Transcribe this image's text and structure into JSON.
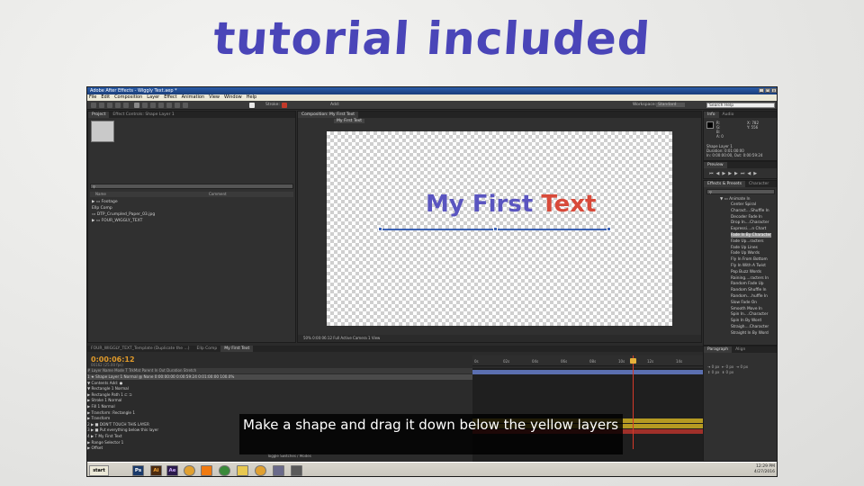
{
  "headline": "tutorial included",
  "window": {
    "title": "Adobe After Effects - Wiggly Text.aep *"
  },
  "menu": [
    "File",
    "Edit",
    "Composition",
    "Layer",
    "Effect",
    "Animation",
    "View",
    "Window",
    "Help"
  ],
  "toolbar": {
    "workspace_label": "Workspace:",
    "workspace_value": "Standard",
    "search_help": "Search Help",
    "stroke_label": "Stroke:",
    "add_label": "Add:"
  },
  "project_panel": {
    "tabs": [
      "Project",
      "Effect Controls: Shape Layer 1"
    ],
    "col_name": "Name",
    "col_comment": "Comment",
    "items": [
      "Footage",
      "Ellp Comp",
      "DTP_Crumpled_Paper_03.jpg",
      "FOUR_WIGGLY_TEXT"
    ]
  },
  "composition_panel": {
    "tab": "Composition: My First Text",
    "sub_tab": "My First Text",
    "text_part1": "My First ",
    "text_part2": "Text",
    "footer": "50%   0:00:06:12   Full   Active Camera   1 View"
  },
  "info_panel": {
    "tabs": [
      "Info",
      "Audio"
    ],
    "rgba": "R:\nG:\nB:\nA: 0",
    "xy": "X: 782\nY: 556",
    "layer": "Shape Layer 1",
    "duration": "Duration: 0:01:00:00",
    "inout": "In: 0:00:00:00, Out: 0:00:59:24"
  },
  "preview_panel": {
    "tab": "Preview"
  },
  "effects_panel": {
    "tabs": [
      "Effects & Presets",
      "Character"
    ],
    "folder": "Animate In",
    "items": [
      "Center Spiral",
      "Charact....Shuffle In",
      "Decoder Fade In",
      "Drop In....Character",
      "Expressi....n Chart",
      "Fade In By Character",
      "Fade Up...racters",
      "Fade Up Lines",
      "Fade Up Words",
      "Fly In From Bottom",
      "Fly In With A Twist",
      "Pop Buzz Words",
      "Raining....racters In",
      "Random Fade Up",
      "Random Shuffle In",
      "Random....huffle In",
      "Slow Fade On",
      "Smooth Move In",
      "Spin In....Character",
      "Spin In By Word",
      "Straigh....Character",
      "Straight In By Word"
    ],
    "selected_index": 5
  },
  "paragraph_panel": {
    "tabs": [
      "Paragraph",
      "Align"
    ],
    "px1": "0 px",
    "px2": "0 px",
    "px3": "0 px",
    "px4": "0 px",
    "px5": "0 px"
  },
  "timeline": {
    "tabs": [
      "FOUR_WIGGLY_TEXT_Template (Duplicate the ...)",
      "Ellp Comp",
      "My First Text"
    ],
    "timecode": "0:00:06:12",
    "timecode_sub": "00162 (25.00 fps)",
    "columns": "#   Layer Name                                   Mode        T  TrkMat        Parent           In          Out        Duration     Stretch",
    "rows": [
      {
        "text": "1     ★ Shape Layer 1                                      Normal                                @  None           0:00:00:00   0:00:59:24   0:01:00:00   100.0%",
        "sel": true
      },
      {
        "text": "        ▼ Contents                                                                    Add: ●",
        "sel": false
      },
      {
        "text": "          ▼ Rectangle 1                                       Normal",
        "sel": false
      },
      {
        "text": "            ▶ Rectangle Path 1                               ⊏ ⊐",
        "sel": false
      },
      {
        "text": "            ▶ Stroke 1                                          Normal",
        "sel": false
      },
      {
        "text": "            ▶ Fill 1                                             Normal",
        "sel": false
      },
      {
        "text": "            ▶ Transform: Rectangle 1",
        "sel": false
      },
      {
        "text": "        ▶ Transform",
        "sel": false
      },
      {
        "text": "2     ▶ ■ DON'T TOUCH THIS LAYER",
        "sel": false
      },
      {
        "text": "3     ▶ ■ Put everything below this layer",
        "sel": false
      },
      {
        "text": "4     ▶ T My First Text",
        "sel": false
      },
      {
        "text": "          ▶ Range Selector 1",
        "sel": false
      },
      {
        "text": "              ▶ Offset",
        "sel": false
      }
    ],
    "ticks": [
      "0s",
      "02s",
      "04s",
      "06s",
      "08s",
      "10s",
      "12s",
      "14s"
    ],
    "footer": "Toggle Switches / Modes"
  },
  "taskbar": {
    "start": "start",
    "apps": [
      "Ps",
      "Ai",
      "Ae"
    ],
    "time": "12:29 PM",
    "date": "4/27/2016"
  },
  "caption": "Make a shape and drag it down below the yellow layers"
}
